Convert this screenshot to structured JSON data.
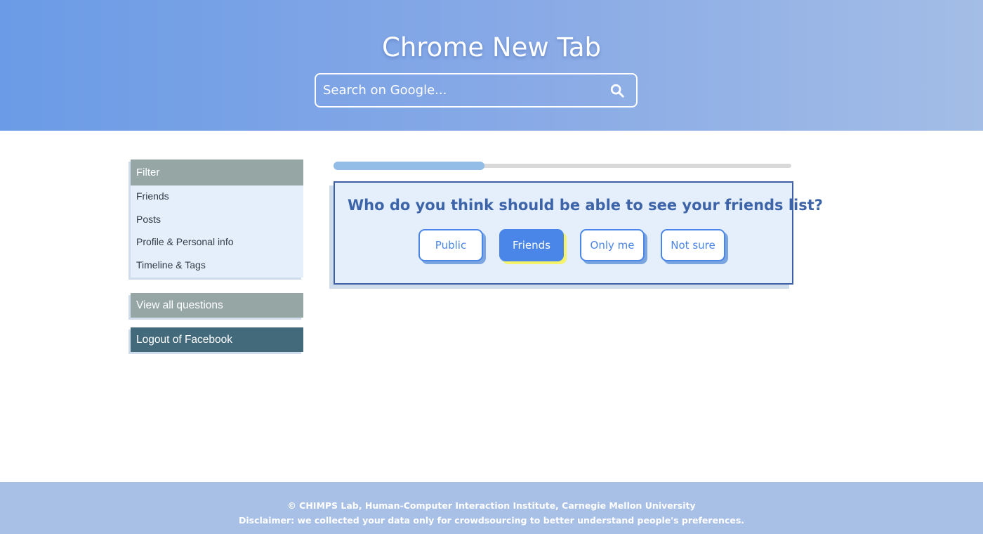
{
  "header": {
    "title": "Chrome New Tab",
    "search_placeholder": "Search on Google..."
  },
  "sidebar": {
    "filter_title": "Filter",
    "filter_items": [
      {
        "label": "Friends"
      },
      {
        "label": "Posts"
      },
      {
        "label": "Profile & Personal info"
      },
      {
        "label": "Timeline & Tags"
      }
    ],
    "view_all_label": "View all questions",
    "logout_label": "Logout of Facebook"
  },
  "progress": {
    "fraction": 0.33
  },
  "question": {
    "text": "Who do you think should be able to see your friends list?",
    "options": [
      {
        "label": "Public",
        "selected": false
      },
      {
        "label": "Friends",
        "selected": true
      },
      {
        "label": "Only me",
        "selected": false
      },
      {
        "label": "Not sure",
        "selected": false
      }
    ]
  },
  "footer": {
    "line1": "© CHIMPS Lab, Human-Computer Interaction Institute, Carnegie Mellon University",
    "line2": "Disclaimer: we collected your data only for crowdsourcing to better understand people's preferences."
  },
  "icons": {
    "search": "search-icon"
  },
  "colors": {
    "accent": "#4a86e8",
    "question_text": "#3d64a8",
    "logout_bg": "#436a7b",
    "filter_bg": "#95a6a5"
  }
}
